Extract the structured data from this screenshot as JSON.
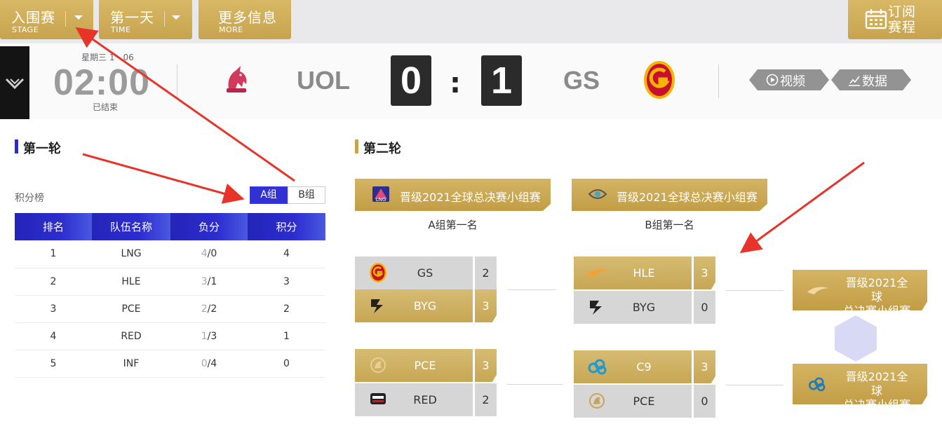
{
  "topbar": {
    "stage": {
      "label": "入围赛",
      "sub": "STAGE"
    },
    "time": {
      "label": "第一天",
      "sub": "TIME"
    },
    "more": {
      "label": "更多信息",
      "sub": "MORE"
    },
    "subscribe": {
      "label_line1": "订阅",
      "label_line2": "赛程",
      "icon": "calendar-icon"
    }
  },
  "match": {
    "weekday": "星期三 1",
    "weekday_suffix": "06",
    "time": "02:00",
    "status": "已结束",
    "home": {
      "abbr": "UOL",
      "logo": "unicorns-of-love-logo"
    },
    "away": {
      "abbr": "GS",
      "logo": "galatasaray-logo"
    },
    "home_score": "0",
    "colon": ":",
    "away_score": "1",
    "video_label": "视频",
    "data_label": "数据"
  },
  "round1": {
    "title": "第一轮",
    "standing_label": "积分榜",
    "groups": [
      "A组",
      "B组"
    ],
    "active_group": "A组",
    "columns": [
      "排名",
      "队伍名称",
      "负分",
      "积分"
    ],
    "rows": [
      {
        "rank": "1",
        "team": "LNG",
        "w": "4",
        "l": "/0",
        "pts": "4"
      },
      {
        "rank": "2",
        "team": "HLE",
        "w": "3",
        "l": "/1",
        "pts": "3"
      },
      {
        "rank": "3",
        "team": "PCE",
        "w": "2",
        "l": "/2",
        "pts": "2"
      },
      {
        "rank": "4",
        "team": "RED",
        "w": "1",
        "l": "/3",
        "pts": "1"
      },
      {
        "rank": "5",
        "team": "INF",
        "w": "0",
        "l": "/4",
        "pts": "0"
      }
    ]
  },
  "round2": {
    "title": "第二轮",
    "banner_a": {
      "label": "晋级2021全球总决赛小组赛",
      "logo": "lng-logo"
    },
    "banner_b": {
      "label": "晋级2021全球总决赛小组赛",
      "logo": "dfm-logo"
    },
    "group_a_first": "A组第一名",
    "group_b_first": "B组第一名",
    "matches": [
      {
        "top": {
          "team": "GS",
          "score": "2",
          "result": "lose"
        },
        "bottom": {
          "team": "BYG",
          "score": "3",
          "result": "win"
        }
      },
      {
        "top": {
          "team": "PCE",
          "score": "3",
          "result": "win"
        },
        "bottom": {
          "team": "RED",
          "score": "2",
          "result": "lose"
        }
      },
      {
        "top": {
          "team": "HLE",
          "score": "3",
          "result": "win"
        },
        "bottom": {
          "team": "BYG",
          "score": "0",
          "result": "lose"
        }
      },
      {
        "top": {
          "team": "C9",
          "score": "3",
          "result": "win"
        },
        "bottom": {
          "team": "PCE",
          "score": "0",
          "result": "lose"
        }
      }
    ],
    "advance_1": {
      "line1": "晋级2021全球",
      "line2": "总决赛小组赛",
      "logo": "hle-logo"
    },
    "advance_2": {
      "line1": "晋级2021全球",
      "line2": "总决赛小组赛",
      "logo": "cloud9-logo"
    }
  },
  "colors": {
    "gold": "#c7a34e",
    "blue": "#2d2dcf",
    "arrow": "#e8332b"
  }
}
